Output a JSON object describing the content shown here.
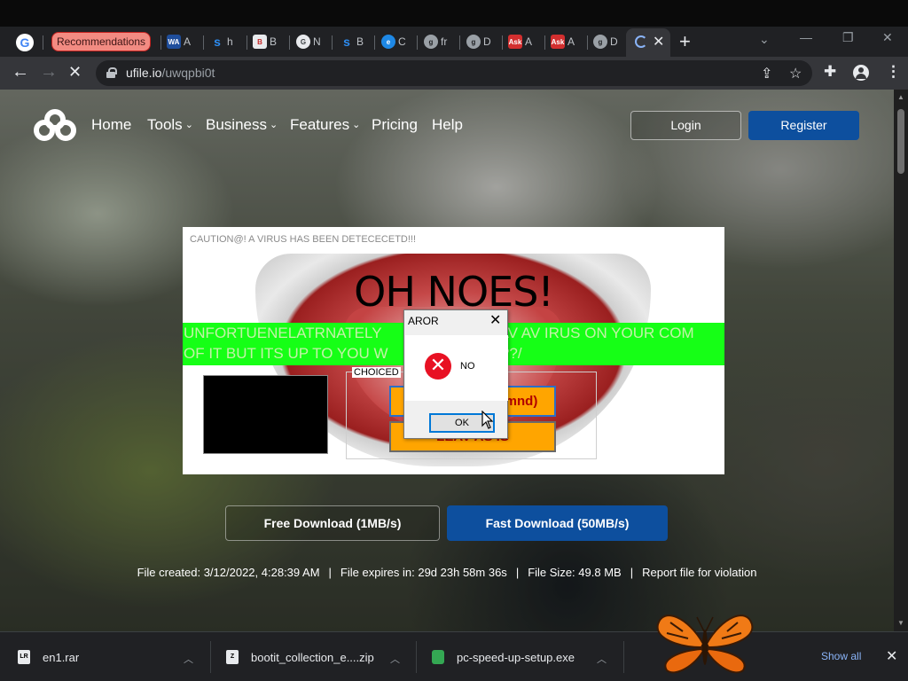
{
  "browser": {
    "tabs": [
      {
        "label": "Recommendations"
      },
      {
        "favicon": "WA",
        "label": "A"
      },
      {
        "favicon": "s",
        "label": "h"
      },
      {
        "favicon": "B",
        "label": "B"
      },
      {
        "favicon": "G",
        "label": "N"
      },
      {
        "favicon": "s",
        "label": "B"
      },
      {
        "favicon": "e",
        "label": "C"
      },
      {
        "favicon": "g",
        "label": "fr"
      },
      {
        "favicon": "g",
        "label": "D"
      },
      {
        "favicon": "Ask",
        "label": "A"
      },
      {
        "favicon": "Ask",
        "label": "A"
      },
      {
        "favicon": "g",
        "label": "D"
      }
    ],
    "url_host": "ufile.io",
    "url_path": "/uwqpbi0t"
  },
  "site": {
    "nav": [
      {
        "label": "Home"
      },
      {
        "label": "Tools",
        "dropdown": true
      },
      {
        "label": "Business",
        "dropdown": true
      },
      {
        "label": "Features",
        "dropdown": true
      },
      {
        "label": "Pricing"
      },
      {
        "label": "Help"
      }
    ],
    "login_label": "Login",
    "register_label": "Register",
    "free_download_label": "Free Download (1MB/s)",
    "fast_download_label": "Fast Download (50MB/s)",
    "file_created": "File created: 3/12/2022, 4:28:39 AM",
    "file_expires": "File expires in: 29d 23h 58m 36s",
    "file_size": "File Size: 49.8 MB",
    "report_label": "Report file for violation",
    "colors": {
      "accent": "#0d4f9e"
    }
  },
  "virus_window": {
    "caption": "CAUTION@! A VIRUS HAS BEEN DETECECETD!!!",
    "headline": "OH NOES!",
    "marquee_line1": "UNFORTUENELATRNATELY",
    "marquee_mid1": "AV AV IRUS ON YOUR COM",
    "marquee_line2": "OF IT BUT ITS UP TO YOU W",
    "marquee_mid2": "???/",
    "group_label": "CHOICED",
    "option1": "mnd)",
    "option2": "LEAV AS IS"
  },
  "dialog": {
    "title": "AROR",
    "message": "NO",
    "ok_label": "OK"
  },
  "downloads": {
    "items": [
      {
        "name": "en1.rar",
        "icon": "rar-icon"
      },
      {
        "name": "bootit_collection_e....zip",
        "icon": "zip-icon"
      },
      {
        "name": "pc-speed-up-setup.exe",
        "icon": "exe-icon"
      }
    ],
    "show_all_label": "Show all"
  }
}
